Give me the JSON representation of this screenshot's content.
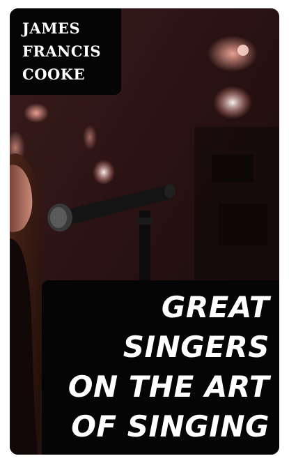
{
  "cover": {
    "author_lines": [
      "JAMES",
      "FRANCIS",
      "COOKE"
    ],
    "title_lines": [
      "GREAT",
      "SINGERS",
      "ON THE ART",
      "OF SINGING"
    ],
    "colors": {
      "box_background": "#050505",
      "text": "#ffffff",
      "photo_background": "#2a1414"
    },
    "photo_description_icon": "singer-with-microphone"
  }
}
